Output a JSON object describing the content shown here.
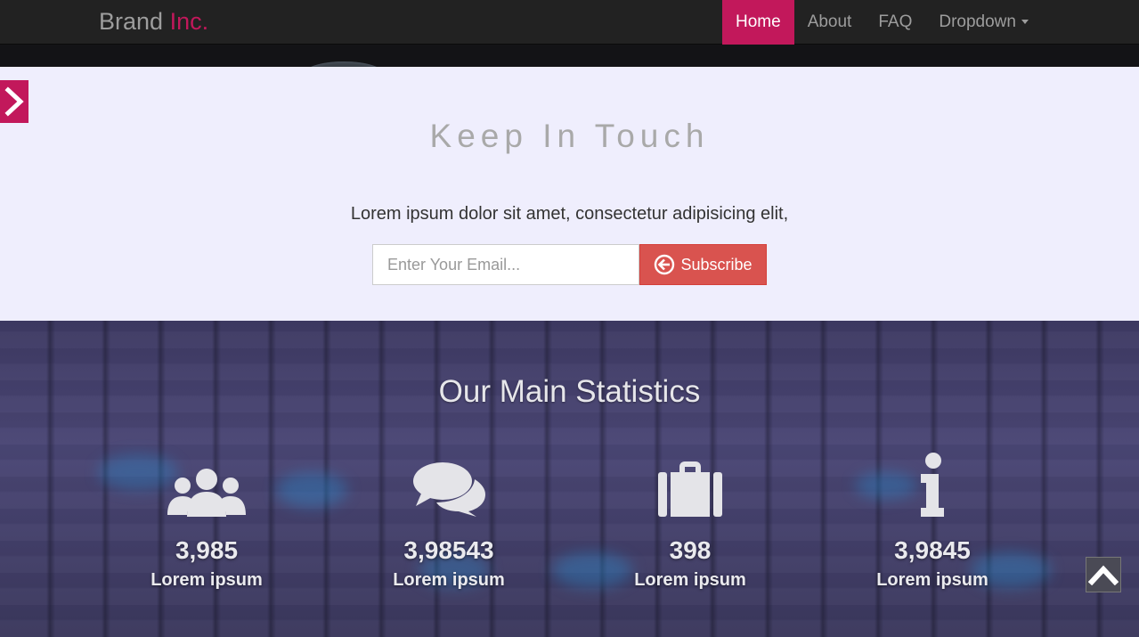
{
  "navbar": {
    "brand_main": "Brand",
    "brand_accent": "Inc.",
    "items": [
      {
        "label": "Home"
      },
      {
        "label": "About"
      },
      {
        "label": "FAQ"
      },
      {
        "label": "Dropdown"
      }
    ],
    "active_item": "Home"
  },
  "subscribe": {
    "title": "Keep In Touch",
    "text": "Lorem ipsum dolor sit amet, consectetur adipisicing elit,",
    "email_placeholder": "Enter Your Email...",
    "button_label": "Subscribe"
  },
  "stats": {
    "title": "Our Main Statistics",
    "items": [
      {
        "icon": "users-icon",
        "value": "3,985",
        "label": "Lorem ipsum"
      },
      {
        "icon": "comments-icon",
        "value": "3,98543",
        "label": "Lorem ipsum"
      },
      {
        "icon": "briefcase-icon",
        "value": "398",
        "label": "Lorem ipsum"
      },
      {
        "icon": "info-icon",
        "value": "3,9845",
        "label": "Lorem ipsum"
      }
    ]
  },
  "colors": {
    "accent": "#c2185b",
    "subscribe_button": "#d9534f",
    "subscribe_bg": "#efeefd",
    "navbar_bg": "#222222"
  },
  "controls": {
    "side_toggle_icon": "chevron-right-icon",
    "back_to_top_icon": "chevron-up-icon"
  }
}
